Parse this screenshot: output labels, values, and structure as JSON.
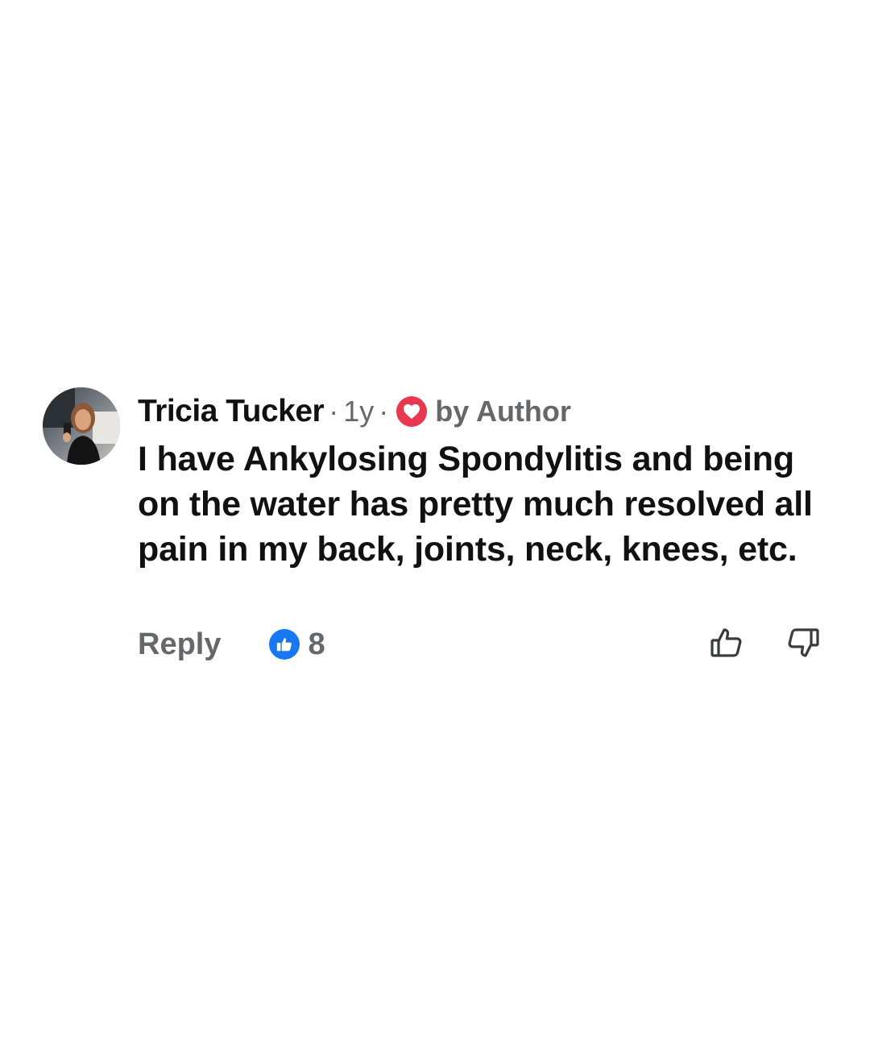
{
  "comment": {
    "author": "Tricia Tucker",
    "separator": "·",
    "timestamp": "1y",
    "author_reaction_label": "by Author",
    "text": "I have Ankylosing Spondylitis and being on the water has pretty much resolved all pain in my back, joints, neck, knees, etc.",
    "reply_label": "Reply",
    "like_count": "8"
  },
  "icons": {
    "author_reaction": "heart-icon",
    "reaction_summary": "thumbs-up-icon",
    "upvote": "thumbs-up-outline-icon",
    "downvote": "thumbs-down-outline-icon"
  },
  "colors": {
    "heart_badge": "#e8384f",
    "like_badge": "#1877f2",
    "meta_text": "#65676b",
    "primary_text": "#111111"
  }
}
